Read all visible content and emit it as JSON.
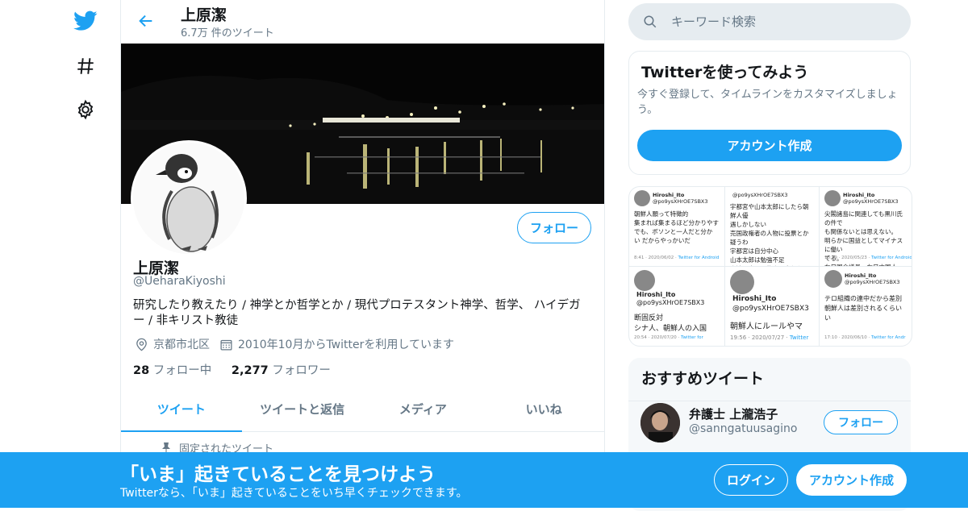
{
  "colors": {
    "accent": "#1da1f2",
    "secondary_text": "#657786",
    "border": "#e6ecf0"
  },
  "nav": {
    "items": [
      {
        "icon": "twitter-bird-icon"
      },
      {
        "icon": "hashtag-icon"
      },
      {
        "icon": "gear-icon"
      }
    ]
  },
  "header": {
    "name": "上原潔",
    "tweet_count": "6.7万 件のツイート"
  },
  "profile": {
    "follow_label": "フォロー",
    "name": "上原潔",
    "handle": "@UeharaKiyoshi",
    "bio": "研究したり教えたり / 神学とか哲学とか / 現代プロテスタント神学、哲学、 ハイデガー / 非キリスト教徒",
    "location": "京都市北区",
    "joined": "2010年10月からTwitterを利用しています",
    "following_count": "28",
    "following_label": " フォロー中",
    "followers_count": "2,277",
    "followers_label": " フォロワー"
  },
  "tabs": [
    {
      "label": "ツイート",
      "active": true
    },
    {
      "label": "ツイートと返信"
    },
    {
      "label": "メディア"
    },
    {
      "label": "いいね"
    }
  ],
  "pinned_label": "固定されたツイート",
  "search": {
    "placeholder": "キーワード検索"
  },
  "signup_card": {
    "title": "Twitterを使ってみよう",
    "description": "今すぐ登録して、タイムラインをカスタマイズしましょう。",
    "button": "アカウント作成"
  },
  "media_thumbs": [
    {
      "name": "Hiroshi_Ito",
      "handle": "@po9ysXHrOE7SBX3",
      "text": "朝鮮人願って特徴的\n集まれば集まるほど分かりやす\nでも、ボソンと一人だと分か\nい だからやっかいだ",
      "footer": "8:41 · 2020/06/02 · ",
      "footer_link": "Twitter for Android"
    },
    {
      "name": "",
      "handle": "@po9ysXHrOE7SBX3",
      "text": "宇都宮や山本太郎にしたら朝鮮人優\n遇しかしない\n売国政権者の人物に投票とか疑うわ\n宇都宮は自分中心\n山本太郎は勉強不足\n小池百合子は約束も守れない\n本当に東京を変えたいなら桜井誠一\n択でしょう",
      "footer": "",
      "footer_link": ""
    },
    {
      "name": "Hiroshi_Ito",
      "handle": "@po9ysXHrOE7SBX3",
      "text": "尖閣諸島に関連しても黒川氏の件で\nも関係ないとは思えない。\n明らかに国益としてマイナスに働い\nてる。\n在日国会議員、在日中国人、在日朝\n鮮人 絶対に許さんぞ",
      "footer": "15:39 · 2020/05/23 · ",
      "footer_link": "Twitter for Android"
    },
    {
      "name": "Hiroshi_Ito",
      "handle": "@po9ysXHrOE7SBX3",
      "text": "断固反対\nシナ人、朝鮮人の入国",
      "footer": "20:54 · 2020/07/20 · ",
      "footer_link": "Twitter for"
    },
    {
      "name": "Hiroshi_Ito",
      "handle": "@po9ysXHrOE7SBX3",
      "text": "朝鮮人にルールやマ",
      "footer": "19:56 · 2020/07/27 · ",
      "footer_link": "Twitter"
    },
    {
      "name": "Hiroshi_Ito",
      "handle": "@po9ysXHrOE7SBX3",
      "text": "テロ組織の連中だから差別\n朝鮮人は差別されるくらい\nい",
      "footer": "17:10 · 2020/06/10 · ",
      "footer_link": "Twitter for Andr"
    }
  ],
  "recommended": {
    "title": "おすすめツイート",
    "user_name": "弁護士 上瀧浩子",
    "user_handle": "@sanngatuusagino",
    "follow_label": "フォロー"
  },
  "bottom_bar": {
    "title": "「いま」起きていることを見つけよう",
    "subtitle": "Twitterなら、「いま」起きていることをいち早くチェックできます。",
    "login": "ログイン",
    "signup": "アカウント作成"
  }
}
